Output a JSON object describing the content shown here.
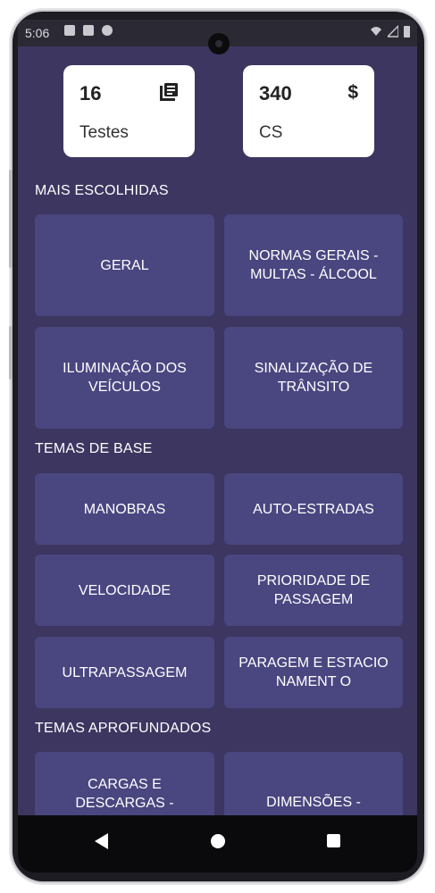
{
  "status": {
    "time": "5:06"
  },
  "stats": [
    {
      "value": "16",
      "label": "Testes",
      "icon": "book-icon"
    },
    {
      "value": "340",
      "label": "CS",
      "icon_glyph": "$",
      "icon": "dollar-icon"
    }
  ],
  "sections": {
    "popular": "MAIS ESCOLHIDAS",
    "basic": "TEMAS DE BASE",
    "advanced": "TEMAS APROFUNDADOS"
  },
  "tiles": {
    "geral": "GERAL",
    "normas": "NORMAS GERAIS - MULTAS - ÁLCOOL",
    "iluminacao": "ILUMINAÇÃO DOS VEÍCULOS",
    "sinalizacao": "SINALIZAÇÃO DE TRÂNSITO",
    "manobras": "MANOBRAS",
    "autoestradas": "AUTO-ESTRADAS",
    "velocidade": "VELOCIDADE",
    "prioridade": "PRIORIDADE DE PASSAGEM",
    "ultrapassagem": "ULTRAPASSAGEM",
    "paragem": "PARAGEM E ESTACIONAMENT O",
    "cargas": "CARGAS E DESCARGAS -",
    "dimensoes": "DIMENSÕES -"
  },
  "colors": {
    "background": "#3c3660",
    "tile": "#4a4680",
    "card": "#ffffff"
  }
}
